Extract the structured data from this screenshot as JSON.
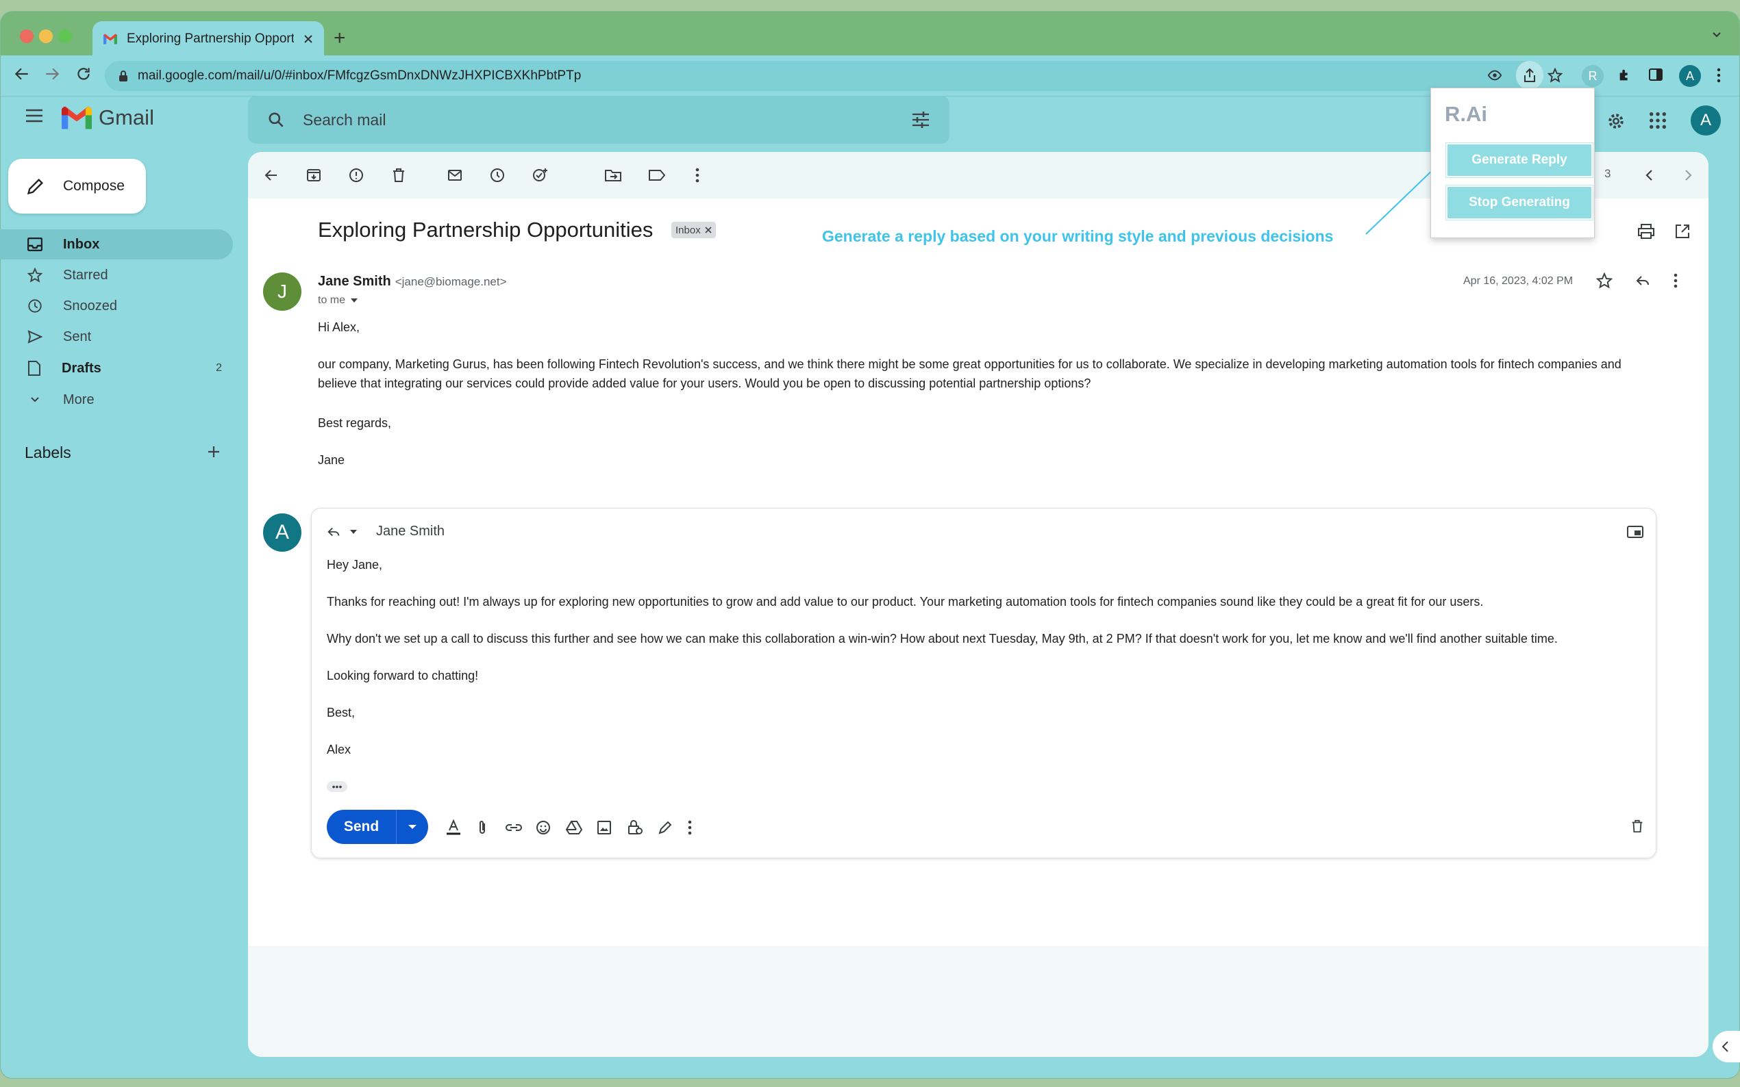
{
  "browser": {
    "tab_title": "Exploring Partnership Opportunities",
    "url": "mail.google.com/mail/u/0/#inbox/FMfcgzGsmDnxDNWzJHXPICBXKhPbtPTp",
    "profile_initial": "A",
    "extension_initial": "R"
  },
  "gmail": {
    "brand": "Gmail",
    "search_placeholder": "Search mail",
    "compose_label": "Compose",
    "nav": [
      {
        "label": "Inbox",
        "count": ""
      },
      {
        "label": "Starred",
        "count": ""
      },
      {
        "label": "Snoozed",
        "count": ""
      },
      {
        "label": "Sent",
        "count": ""
      },
      {
        "label": "Drafts",
        "count": "2"
      },
      {
        "label": "More",
        "count": ""
      }
    ],
    "labels_heading": "Labels",
    "account_initial": "A"
  },
  "thread": {
    "pager_fragment": "3",
    "subject": "Exploring Partnership Opportunities",
    "inbox_chip": "Inbox",
    "hint": "Generate a reply based on your writing style and previous decisions",
    "message": {
      "avatar_initial": "J",
      "sender_name": "Jane Smith",
      "sender_email": "<jane@biomage.net>",
      "to": "to me",
      "date": "Apr 16, 2023, 4:02 PM",
      "greeting": "Hi Alex,",
      "paragraph": "our company, Marketing Gurus, has been following Fintech Revolution's success, and we think there might be some great opportunities for us to collaborate. We specialize in developing marketing automation tools for fintech companies and believe that integrating our services could provide added value for your users. Would you be open to discussing potential partnership options?",
      "signoff": "Best regards,",
      "signature": "Jane"
    },
    "reply": {
      "avatar_initial": "A",
      "to": "Jane Smith",
      "lines": [
        "Hey Jane,",
        "Thanks for reaching out! I'm always up for exploring new opportunities to grow and add value to our product. Your marketing automation tools for fintech companies sound like they could be a great fit for our users.",
        "Why don't we set up a call to discuss this further and see how we can make this collaboration a win-win? How about next Tuesday, May 9th, at 2 PM? If that doesn't work for you, let me know and we'll find another suitable time.",
        "Looking forward to chatting!",
        "Best,",
        "Alex"
      ],
      "ellipsis": "•••",
      "send_label": "Send",
      "format_icons": [
        "text-format-icon",
        "attach-icon",
        "link-icon",
        "emoji-icon",
        "drive-icon",
        "photo-icon",
        "confidential-icon",
        "signature-icon",
        "more-options-icon"
      ]
    }
  },
  "rai": {
    "title": "R.Ai",
    "generate_label": "Generate Reply",
    "stop_label": "Stop Generating"
  },
  "colors": {
    "accent": "#3ec3ea",
    "send": "#0b57d0",
    "background": "#8fd9df"
  }
}
